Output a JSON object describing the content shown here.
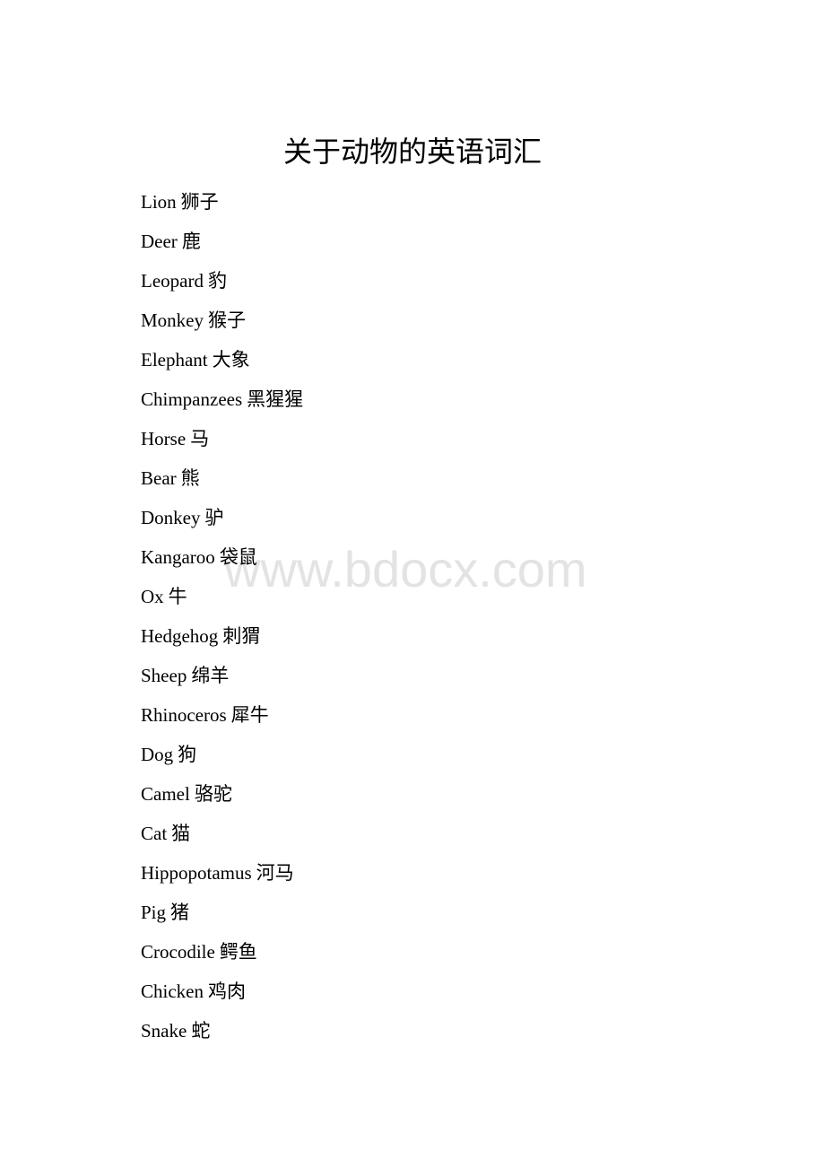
{
  "document": {
    "title": "关于动物的英语词汇",
    "watermark": "www.bdocx.com",
    "entries": [
      {
        "english": "Lion",
        "chinese": "狮子"
      },
      {
        "english": "Deer",
        "chinese": "鹿"
      },
      {
        "english": "Leopard",
        "chinese": "豹"
      },
      {
        "english": "Monkey",
        "chinese": "猴子"
      },
      {
        "english": "Elephant",
        "chinese": "大象"
      },
      {
        "english": "Chimpanzees",
        "chinese": "黑猩猩"
      },
      {
        "english": "Horse",
        "chinese": "马"
      },
      {
        "english": "Bear",
        "chinese": "熊"
      },
      {
        "english": "Donkey",
        "chinese": "驴"
      },
      {
        "english": "Kangaroo",
        "chinese": "袋鼠"
      },
      {
        "english": "Ox",
        "chinese": "牛"
      },
      {
        "english": "Hedgehog",
        "chinese": "刺猬"
      },
      {
        "english": "Sheep",
        "chinese": "绵羊"
      },
      {
        "english": "Rhinoceros",
        "chinese": "犀牛"
      },
      {
        "english": "Dog",
        "chinese": "狗"
      },
      {
        "english": "Camel",
        "chinese": "骆驼"
      },
      {
        "english": "Cat",
        "chinese": "猫"
      },
      {
        "english": "Hippopotamus",
        "chinese": "河马"
      },
      {
        "english": "Pig",
        "chinese": "猪"
      },
      {
        "english": "Crocodile",
        "chinese": "鳄鱼"
      },
      {
        "english": "Chicken",
        "chinese": "鸡肉"
      },
      {
        "english": "Snake",
        "chinese": "蛇"
      }
    ]
  }
}
